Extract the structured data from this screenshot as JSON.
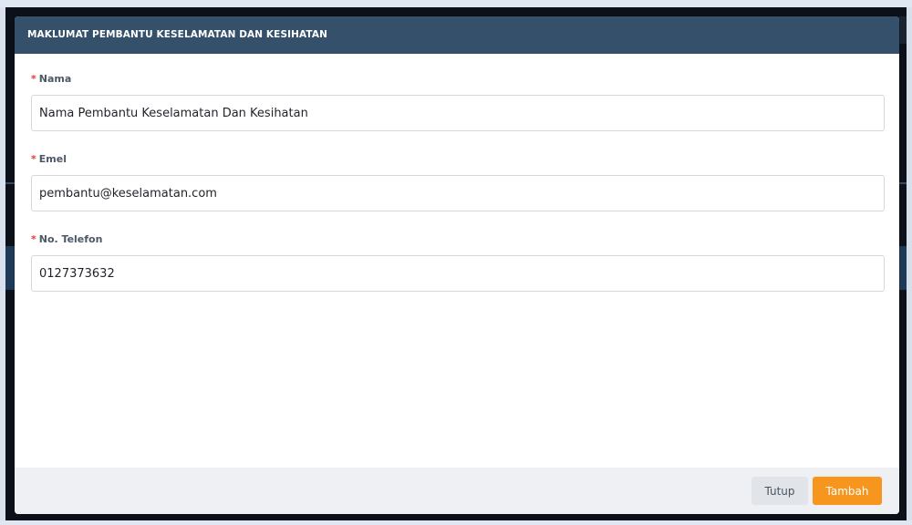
{
  "modal": {
    "title": "MAKLUMAT PEMBANTU KESELAMATAN DAN KESIHATAN"
  },
  "form": {
    "required_marker": "*",
    "fields": [
      {
        "label": "Nama",
        "value": "Nama Pembantu Keselamatan Dan Kesihatan"
      },
      {
        "label": "Emel",
        "value": "pembantu@keselamatan.com"
      },
      {
        "label": "No. Telefon",
        "value": "0127373632"
      }
    ]
  },
  "footer": {
    "close_label": "Tutup",
    "add_label": "Tambah"
  },
  "colors": {
    "header_bg": "#34506b",
    "primary_button": "#f7961e",
    "required_marker": "#e33b3b"
  }
}
